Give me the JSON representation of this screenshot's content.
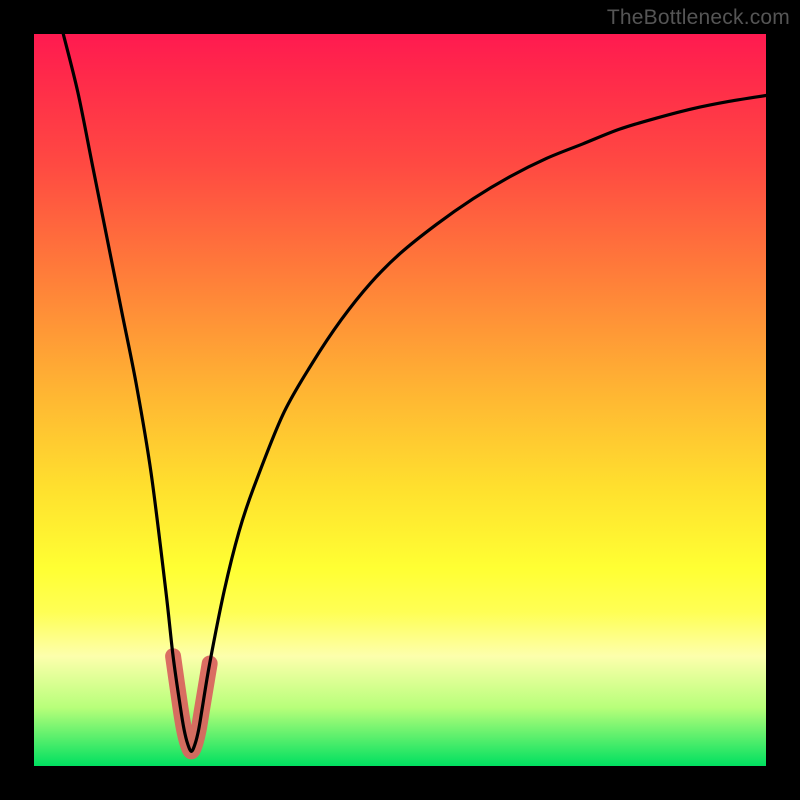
{
  "watermark": "TheBottleneck.com",
  "colors": {
    "frame": "#000000",
    "gradient_top": "#ff1a50",
    "gradient_bottom": "#00e060",
    "curve": "#000000",
    "accent": "#d9655f"
  },
  "chart_data": {
    "type": "line",
    "title": "",
    "xlabel": "",
    "ylabel": "",
    "xlim": [
      0,
      100
    ],
    "ylim": [
      0,
      100
    ],
    "grid": false,
    "legend": false,
    "series": [
      {
        "name": "bottleneck-curve",
        "x": [
          4,
          6,
          8,
          10,
          12,
          14,
          16,
          18,
          19,
          20,
          20.5,
          21,
          21.5,
          22,
          22.5,
          23,
          24,
          26,
          28,
          30,
          34,
          38,
          42,
          46,
          50,
          55,
          60,
          65,
          70,
          75,
          80,
          85,
          90,
          95,
          100
        ],
        "values": [
          100,
          92,
          82,
          72,
          62,
          52,
          40,
          24,
          15,
          8,
          5,
          3,
          2,
          3,
          5,
          8,
          14,
          24,
          32,
          38,
          48,
          55,
          61,
          66,
          70,
          74,
          77.5,
          80.5,
          83,
          85,
          87,
          88.5,
          89.8,
          90.8,
          91.6
        ]
      }
    ],
    "accent_region": {
      "name": "optimal-zone",
      "x_range": [
        19,
        24
      ],
      "y_range": [
        2,
        15
      ]
    }
  }
}
